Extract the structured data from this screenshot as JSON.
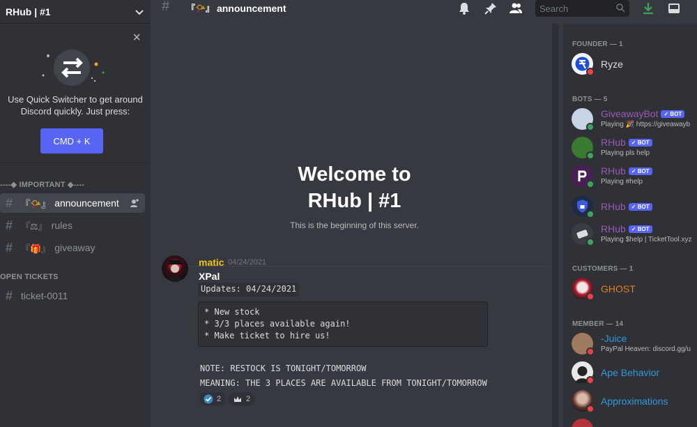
{
  "server": {
    "name": "RHub | #1"
  },
  "quick_switcher": {
    "text_line1": "Use Quick Switcher to get around",
    "text_line2": "Discord quickly. Just press:",
    "shortcut": "CMD + K"
  },
  "sidebar": {
    "categories": [
      {
        "name": "----◆ IMPORTANT ◆----"
      },
      {
        "name": "OPEN TICKETS"
      }
    ],
    "channels": [
      {
        "emoji": "『📯』",
        "name": "announcement"
      },
      {
        "emoji": "『⚖』",
        "name": "rules"
      },
      {
        "emoji": "『🎁』",
        "name": "giveaway"
      },
      {
        "emoji": "",
        "name": "ticket-0011"
      }
    ]
  },
  "topbar": {
    "channel_emoji": "『📯』",
    "channel_name": "announcement",
    "search_placeholder": "Search"
  },
  "welcome": {
    "line1": "Welcome to",
    "line2": "RHub | #1",
    "subtitle": "This is the beginning of this server."
  },
  "message": {
    "author": "matic",
    "timestamp": "04/24/2021",
    "title": "XPal",
    "updates": "Updates: 04/24/2021",
    "code_lines": [
      "* New stock",
      "* 3/3 places available again!",
      "* Make ticket to hire us!"
    ],
    "note": "NOTE: RESTOCK IS TONIGHT/TOMORROW",
    "meaning": "MEANING: THE 3 PLACES ARE AVAILABLE FROM TONIGHT/TOMORROW",
    "reactions": [
      {
        "icon": "check-badge-icon",
        "count": "2"
      },
      {
        "icon": "crown-icon",
        "count": "2"
      }
    ]
  },
  "members": {
    "categories": [
      "FOUNDER — 1",
      "BOTS — 5",
      "CUSTOMERS — 1",
      "MEMBER — 14"
    ],
    "founder": [
      {
        "name": "Ryze",
        "color": "#dcddde"
      }
    ],
    "bots": [
      {
        "name": "GiveawayBot",
        "tag": "✓ BOT",
        "activity": "Playing 🎉 https://giveawayb"
      },
      {
        "name": "RHub",
        "tag": "✓ BOT",
        "activity": "Playing pls help"
      },
      {
        "name": "RHub",
        "tag": "✓ BOT",
        "activity": "Playing #help"
      },
      {
        "name": "RHub",
        "tag": "✓ BOT",
        "activity": ""
      },
      {
        "name": "RHub",
        "tag": "✓ BOT",
        "activity": "Playing $help | TicketTool.xyz"
      }
    ],
    "customers": [
      {
        "name": "GHOST"
      }
    ],
    "members": [
      {
        "name": "-Juice",
        "activity": "PayPal Heaven: discord.gg/u"
      },
      {
        "name": "Ape Behavior",
        "activity": ""
      },
      {
        "name": "Approximations",
        "activity": ""
      }
    ]
  },
  "colors": {
    "accent": "#5865f2",
    "bot_name": "#9b59b6",
    "customer_name": "#e67e22",
    "member_name": "#3498db",
    "author": "#f1c40f",
    "online": "#3ba55d",
    "dnd": "#ed4245"
  }
}
